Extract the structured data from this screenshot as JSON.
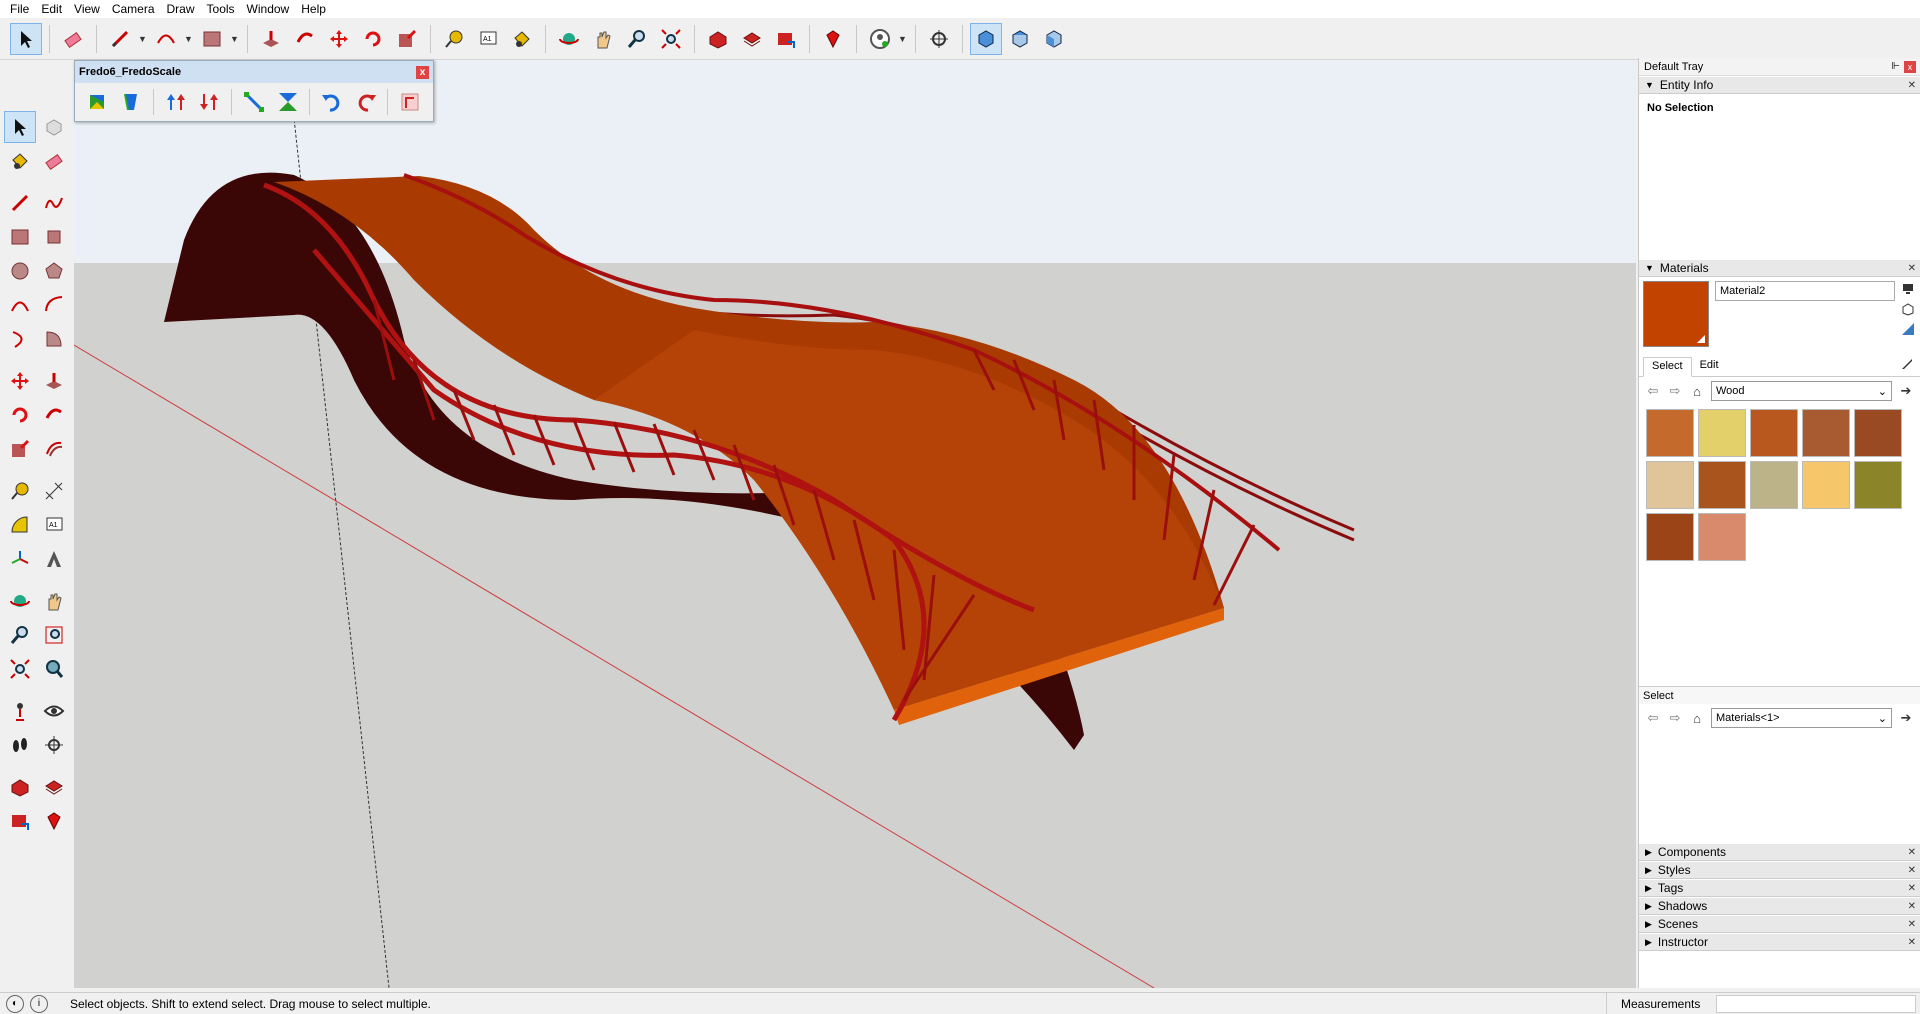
{
  "menu": [
    "File",
    "Edit",
    "View",
    "Camera",
    "Draw",
    "Tools",
    "Window",
    "Help"
  ],
  "main_toolbar": {
    "icons": [
      "select-icon",
      "eraser-icon",
      "pencil-icon",
      "arc-icon",
      "rectangle-icon",
      "push-pull-icon",
      "follow-me-icon",
      "move-icon",
      "rotate-icon",
      "scale-icon",
      "tape-measure-icon",
      "text-icon",
      "paint-bucket-icon",
      "orbit-icon",
      "pan-icon",
      "zoom-icon",
      "zoom-extents-icon",
      "warehouse-icon",
      "extension-warehouse-icon",
      "send-to-layout-icon",
      "ruby-console-icon",
      "account-icon",
      "position-camera-icon",
      "iso-view-icon",
      "top-view-icon",
      "front-view-icon"
    ]
  },
  "fredo_toolbar": {
    "title": "Fredo6_FredoScale",
    "close": "x",
    "icons": [
      "box-scale-icon",
      "tapering-icon",
      "stretch-up-icon",
      "stretch-down-icon",
      "shear-icon",
      "bend-icon",
      "rotate-left-icon",
      "rotate-right-icon",
      "fredo-settings-icon"
    ]
  },
  "tray": {
    "title": "Default Tray",
    "pin": "⊩",
    "close": "x",
    "entity_info": {
      "title": "Entity Info",
      "status": "No Selection"
    },
    "materials": {
      "title": "Materials",
      "current_name": "Material2",
      "current_color": "#c24300",
      "tabs": [
        "Select",
        "Edit"
      ],
      "active_tab": "Select",
      "collection": "Wood",
      "swatches": [
        "#c46a2c",
        "#e3d06a",
        "#b8581e",
        "#a85a30",
        "#9a4a22",
        "#e0c49a",
        "#a8541c",
        "#bcb488",
        "#f6c66a",
        "#8c8428",
        "#9a4418",
        "#d98a6c"
      ]
    },
    "select2": {
      "title": "Select",
      "collection": "Materials<1>"
    },
    "collapsed_panels": [
      "Components",
      "Styles",
      "Tags",
      "Shadows",
      "Scenes",
      "Instructor"
    ]
  },
  "status": {
    "text": "Select objects. Shift to extend select. Drag mouse to select multiple.",
    "measurements_label": "Measurements",
    "measurements_value": ""
  },
  "scene": {
    "sky_color": "#eaf0f5",
    "ground_color": "#d1d1cf",
    "deck_color": "#b53d00",
    "truss_color": "#a01010"
  }
}
